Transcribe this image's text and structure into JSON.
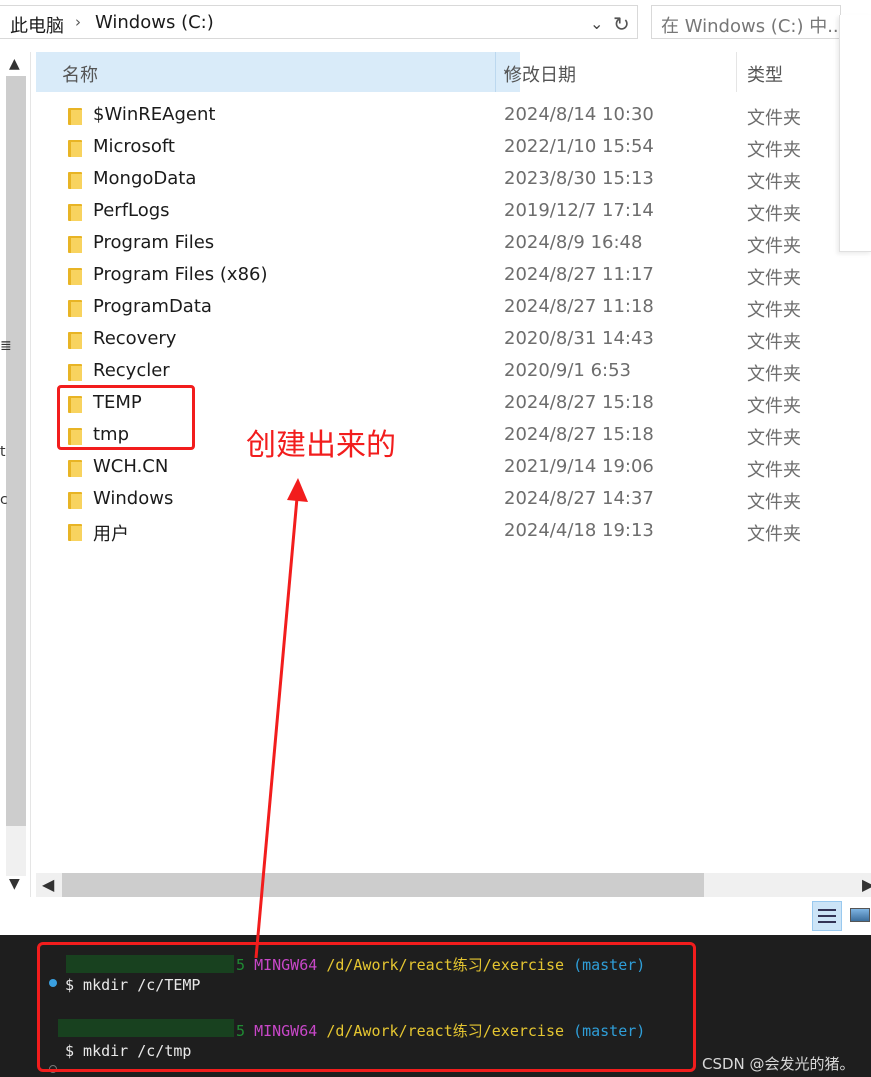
{
  "address": {
    "crumbs": [
      "此电脑",
      "Windows (C:)"
    ],
    "separator": "›",
    "dropdown_icon": "chevron-down-icon",
    "refresh_icon": "refresh-icon",
    "search_placeholder": "在 Windows (C:) 中..."
  },
  "columns": {
    "name": "名称",
    "date": "修改日期",
    "type": "类型",
    "sort_icon": "chevron-down-icon"
  },
  "files": [
    {
      "name": "$WinREAgent",
      "date": "2024/8/14 10:30",
      "type": "文件夹"
    },
    {
      "name": "Microsoft",
      "date": "2022/1/10 15:54",
      "type": "文件夹"
    },
    {
      "name": "MongoData",
      "date": "2023/8/30 15:13",
      "type": "文件夹"
    },
    {
      "name": "PerfLogs",
      "date": "2019/12/7 17:14",
      "type": "文件夹"
    },
    {
      "name": "Program Files",
      "date": "2024/8/9 16:48",
      "type": "文件夹"
    },
    {
      "name": "Program Files (x86)",
      "date": "2024/8/27 11:17",
      "type": "文件夹"
    },
    {
      "name": "ProgramData",
      "date": "2024/8/27 11:18",
      "type": "文件夹"
    },
    {
      "name": "Recovery",
      "date": "2020/8/31 14:43",
      "type": "文件夹"
    },
    {
      "name": "Recycler",
      "date": "2020/9/1 6:53",
      "type": "文件夹"
    },
    {
      "name": "TEMP",
      "date": "2024/8/27 15:18",
      "type": "文件夹"
    },
    {
      "name": "tmp",
      "date": "2024/8/27 15:18",
      "type": "文件夹"
    },
    {
      "name": "WCH.CN",
      "date": "2021/9/14 19:06",
      "type": "文件夹"
    },
    {
      "name": "Windows",
      "date": "2024/8/27 14:37",
      "type": "文件夹"
    },
    {
      "name": "用户",
      "date": "2024/4/18 19:13",
      "type": "文件夹"
    }
  ],
  "nav_fragments": [
    "≣",
    "t",
    "c"
  ],
  "scrollbars": {
    "up": "▲",
    "down": "▼",
    "left": "◀",
    "right": "▶"
  },
  "annotation": {
    "text": "创建出来的",
    "color": "#f21d1d"
  },
  "terminal": {
    "lines": [
      {
        "user_tail": "5",
        "shell": "MINGW64",
        "path": "/d/Awork/react练习/exercise",
        "branch": "(master)",
        "command": "$ mkdir /c/TEMP"
      },
      {
        "user_tail": "5",
        "shell": "MINGW64",
        "path": "/d/Awork/react练习/exercise",
        "branch": "(master)",
        "command": "$ mkdir /c/tmp"
      }
    ],
    "watermark": "CSDN @会发光的猪。"
  }
}
